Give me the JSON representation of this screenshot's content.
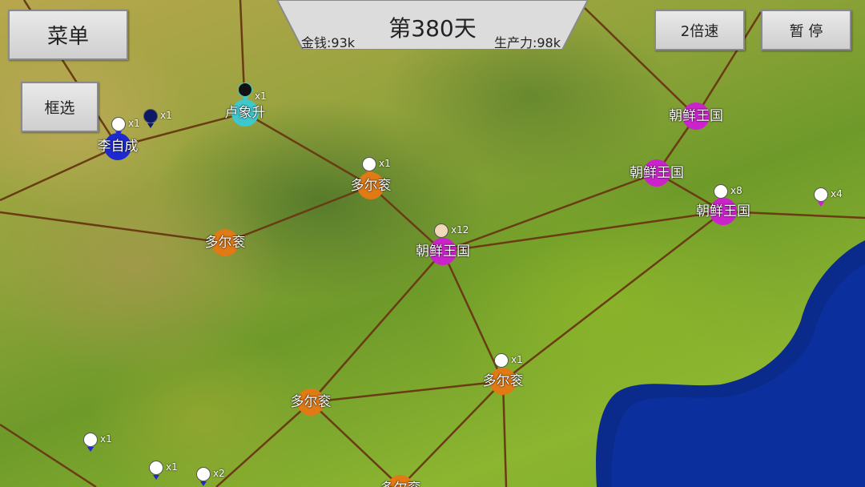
{
  "header": {
    "day": "第380天",
    "money": "金钱:93k",
    "production": "生产力:98k"
  },
  "buttons": {
    "menu": "菜单",
    "box_select": "框选",
    "speed": "2倍速",
    "pause": "暂 停"
  },
  "colors": {
    "korea": "#cc22cc",
    "dorgon": "#e07a14",
    "li_zicheng": "#1e2ad0",
    "lu_xiangsheng": "#3cc8cc",
    "edge": "#6a3c14",
    "sea": "#0a2a8c"
  },
  "map": {
    "nodes": [
      {
        "name": "李自成",
        "faction": "li_zicheng"
      },
      {
        "name": "卢象升",
        "faction": "lu_xiangsheng"
      },
      {
        "name": "多尔衮",
        "faction": "dorgon"
      },
      {
        "name": "多尔衮",
        "faction": "dorgon"
      },
      {
        "name": "朝鲜王国",
        "faction": "korea"
      },
      {
        "name": "朝鲜王国",
        "faction": "korea"
      },
      {
        "name": "朝鲜王国",
        "faction": "korea"
      },
      {
        "name": "朝鲜王国",
        "faction": "korea"
      },
      {
        "name": "多尔衮",
        "faction": "dorgon"
      },
      {
        "name": "多尔衮",
        "faction": "dorgon"
      },
      {
        "name": "多尔衮",
        "faction": "dorgon"
      }
    ],
    "units": [
      {
        "count": "x1"
      },
      {
        "count": "x1"
      },
      {
        "count": "x1"
      },
      {
        "count": "x1"
      },
      {
        "count": "x12"
      },
      {
        "count": "x8"
      },
      {
        "count": "x4"
      },
      {
        "count": "x1"
      },
      {
        "count": "x1"
      },
      {
        "count": "x1"
      },
      {
        "count": "x2"
      }
    ]
  }
}
